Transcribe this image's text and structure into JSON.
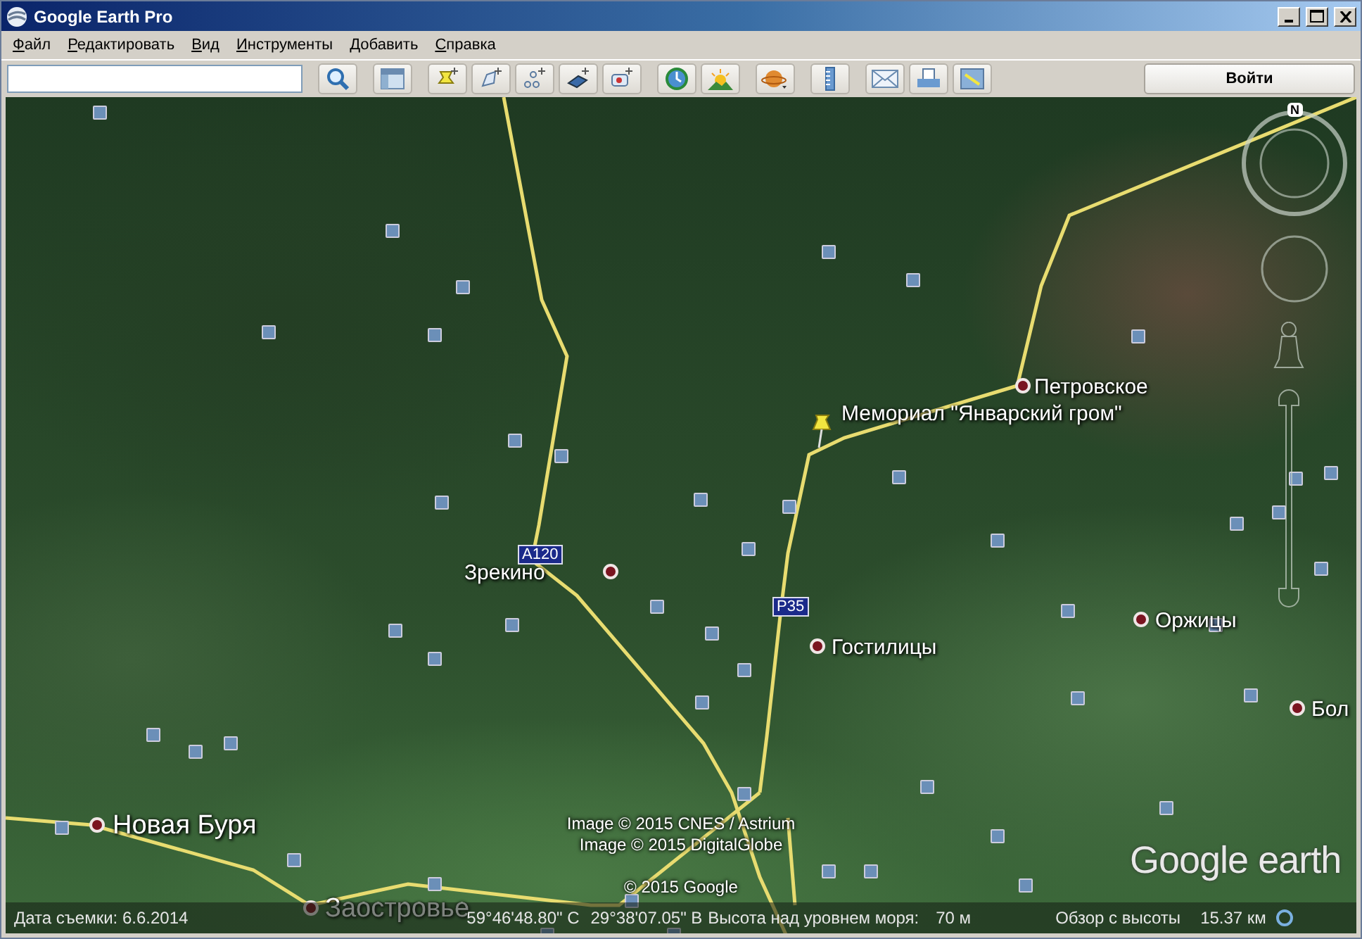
{
  "window": {
    "title": "Google Earth Pro"
  },
  "menu": [
    "Файл",
    "Редактировать",
    "Вид",
    "Инструменты",
    "Добавить",
    "Справка"
  ],
  "toolbar": {
    "sign_in": "Войти"
  },
  "map": {
    "places": [
      {
        "name": "Петровское",
        "kind": "village"
      },
      {
        "name": "Мемориал \"Январский гром\"",
        "kind": "landmark"
      },
      {
        "name": "Зрекино",
        "kind": "village"
      },
      {
        "name": "Гостилицы",
        "kind": "village"
      },
      {
        "name": "Оржицы",
        "kind": "village"
      },
      {
        "name": "Бол",
        "kind": "village"
      },
      {
        "name": "Новая Буря",
        "kind": "town"
      },
      {
        "name": "Заостровье",
        "kind": "town"
      }
    ],
    "road_shields": [
      "A120",
      "P35"
    ],
    "attribution": [
      "Image © 2015 CNES / Astrium",
      "Image © 2015 DigitalGlobe",
      "© 2015 Google"
    ],
    "compass": "N",
    "logo": "Google earth"
  },
  "status_bar": {
    "date": "Дата съемки: 6.6.2014",
    "latitude": "59°46'48.80\" С",
    "longitude": "29°38'07.05\" В",
    "elevation_label": "Высота над уровнем моря:",
    "elevation": "70 м",
    "eye_alt_label": "Обзор с высоты",
    "eye_alt": "15.37 км"
  }
}
